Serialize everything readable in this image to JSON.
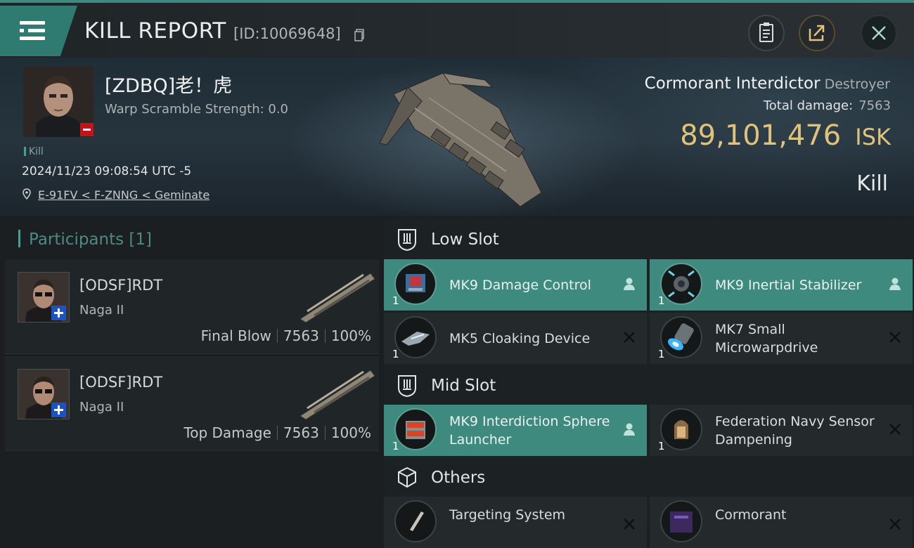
{
  "header": {
    "title": "KILL REPORT",
    "report_id": "[ID:10069648]",
    "clipboard_icon": "clipboard-icon",
    "share_icon": "share-icon",
    "close_icon": "close-icon"
  },
  "victim": {
    "name": "[ZDBQ]老！虎",
    "warp_scramble": "Warp Scramble Strength: 0.0",
    "tag": "Kill",
    "datetime": "2024/11/23 09:08:54 UTC -5",
    "location": "E-91FV < F-ZNNG < Geminate",
    "ship_name": "Cormorant Interdictor",
    "ship_class": "Destroyer",
    "total_damage_label": "Total damage:",
    "total_damage": "7563",
    "isk_value": "89,101,476",
    "isk_unit": "ISK",
    "result": "Kill"
  },
  "participants": {
    "title": "Participants [1]",
    "rows": [
      {
        "name": "[ODSF]RDT",
        "ship": "Naga II",
        "role": "Final Blow",
        "damage": "7563",
        "percent": "100%"
      },
      {
        "name": "[ODSF]RDT",
        "ship": "Naga II",
        "role": "Top Damage",
        "damage": "7563",
        "percent": "100%"
      }
    ]
  },
  "slots": {
    "low": {
      "label": "Low Slot",
      "modules": [
        {
          "name": "MK9 Damage Control",
          "qty": "1",
          "status": "dropped"
        },
        {
          "name": "MK9 Inertial Stabilizer",
          "qty": "1",
          "status": "dropped"
        },
        {
          "name": "MK5 Cloaking Device",
          "qty": "1",
          "status": "destroyed"
        },
        {
          "name": "MK7 Small Microwarpdrive",
          "qty": "1",
          "status": "destroyed"
        }
      ]
    },
    "mid": {
      "label": "Mid Slot",
      "modules": [
        {
          "name": "MK9 Interdiction Sphere Launcher",
          "qty": "1",
          "status": "dropped"
        },
        {
          "name": "Federation Navy Sensor Dampening",
          "qty": "1",
          "status": "destroyed"
        }
      ]
    },
    "others": {
      "label": "Others",
      "modules": [
        {
          "name": "Targeting System",
          "qty": "",
          "status": "destroyed"
        },
        {
          "name": "Cormorant",
          "qty": "",
          "status": "destroyed"
        }
      ]
    }
  },
  "colors": {
    "accent": "#3e8a7f",
    "isk": "#e0c27a",
    "penalty": "#c2141a",
    "corp_badge": "#1a52c8"
  }
}
